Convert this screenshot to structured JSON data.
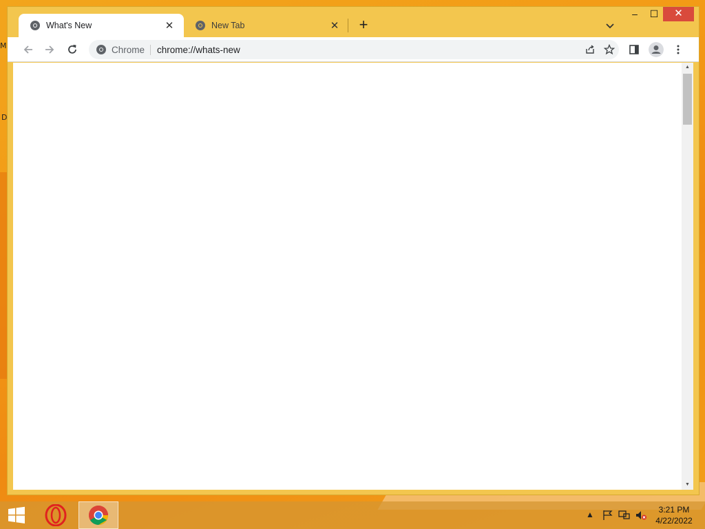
{
  "desktop": {
    "letters": [
      "M",
      "D"
    ]
  },
  "browser": {
    "tabs": [
      {
        "title": "What's New",
        "active": true
      },
      {
        "title": "New Tab",
        "active": false
      }
    ],
    "omnibox": {
      "chip": "Chrome",
      "url": "chrome://whats-new"
    },
    "icons": {
      "back": "back-arrow-icon",
      "forward": "forward-arrow-icon",
      "reload": "reload-icon",
      "share": "share-icon",
      "bookmark": "star-icon",
      "side_panel": "side-panel-icon",
      "profile": "profile-avatar-icon",
      "menu": "kebab-menu-icon"
    }
  },
  "taskbar": {
    "apps": [
      "Start",
      "Opera",
      "Chrome"
    ],
    "clock": {
      "time": "3:21 PM",
      "date": "4/22/2022"
    }
  },
  "colors": {
    "frame": "#f3c64e",
    "close_button": "#d94a3c",
    "desktop": "#f39a16"
  }
}
